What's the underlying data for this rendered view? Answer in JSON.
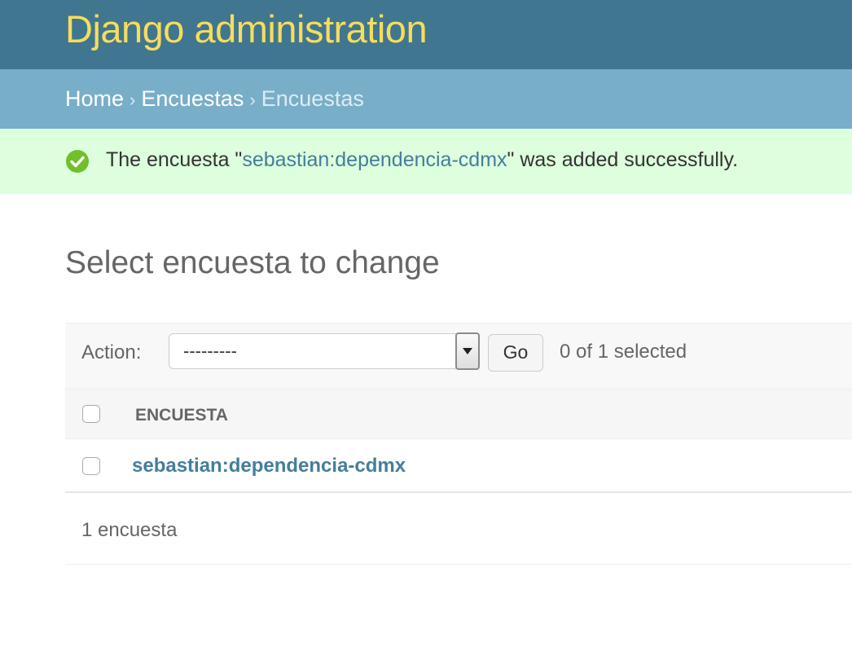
{
  "header": {
    "site_title": "Django administration"
  },
  "breadcrumbs": {
    "home": "Home",
    "separator": "›",
    "app": "Encuestas",
    "current": "Encuestas"
  },
  "message": {
    "type": "success",
    "icon": "check-circle-icon",
    "prefix": "The encuesta \"",
    "object_link": "sebastian:dependencia-cdmx",
    "suffix": "\" was added successfully."
  },
  "content": {
    "title": "Select encuesta to change"
  },
  "actions": {
    "label": "Action:",
    "select_value": "---------",
    "go_label": "Go",
    "counter": "0 of 1 selected"
  },
  "table": {
    "columns": [
      "Encuesta"
    ],
    "rows": [
      {
        "encuesta": "sebastian:dependencia-cdmx",
        "selected": false
      }
    ]
  },
  "paginator": {
    "text": "1 encuesta"
  },
  "colors": {
    "header_bg": "#417690",
    "site_title": "#f5dd5d",
    "breadcrumbs_bg": "#79aec8",
    "success_bg": "#ddffdd",
    "success_icon": "#70bf2b",
    "link": "#447e9b"
  }
}
